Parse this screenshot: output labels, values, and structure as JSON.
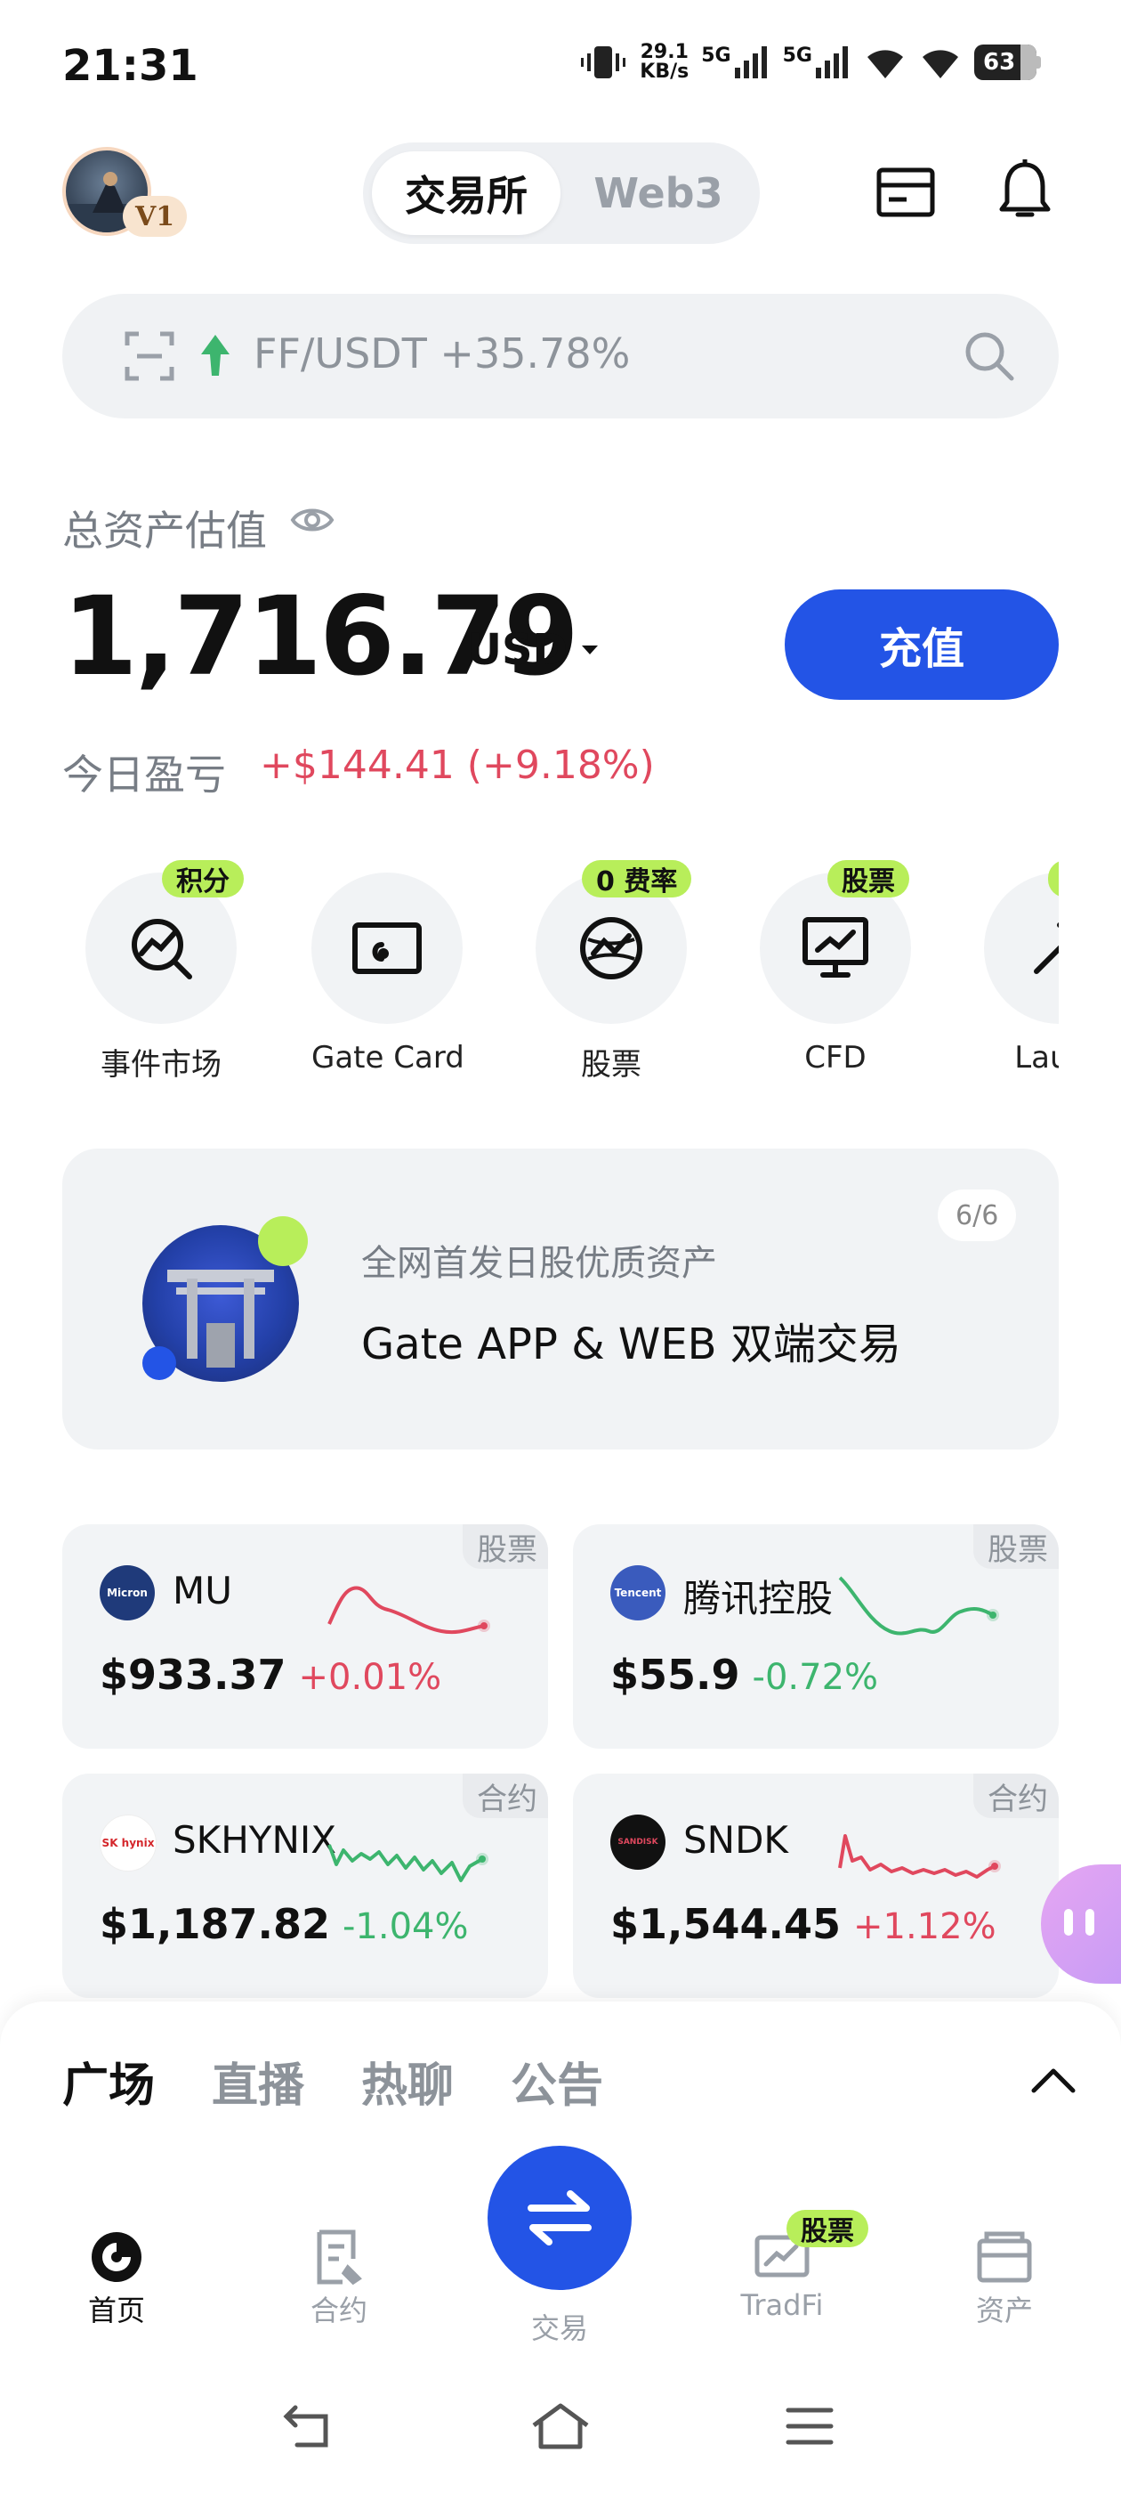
{
  "status_bar": {
    "time": "21:31",
    "net_speed_value": "29.1",
    "net_speed_unit": "KB/s",
    "sim1": "5G",
    "sim2": "5G",
    "battery": "63"
  },
  "header": {
    "avatar_badge": "V1",
    "tabs": [
      "交易所",
      "Web3"
    ],
    "active_tab": "交易所"
  },
  "search": {
    "trending_text": "FF/USDT +35.78%"
  },
  "assets": {
    "label": "总资产估值",
    "balance": "1,716.79",
    "currency": "USD",
    "deposit_label": "充值",
    "pnl_label": "今日盈亏",
    "pnl_value": "+$144.41 (+9.18%)"
  },
  "shortcuts": [
    {
      "label": "事件市场",
      "tag": "积分",
      "icon": "chart-search-icon"
    },
    {
      "label": "Gate Card",
      "tag": "",
      "icon": "card-icon"
    },
    {
      "label": "股票",
      "tag": "0 费率",
      "icon": "globe-icon"
    },
    {
      "label": "CFD",
      "tag": "股票",
      "icon": "monitor-chart-icon"
    },
    {
      "label": "Launc",
      "tag": "",
      "icon": "rocket-icon"
    }
  ],
  "banner": {
    "subtitle": "全网首发日股优质资产",
    "title": "Gate APP & WEB 双端交易",
    "page": "6/6"
  },
  "markets": [
    {
      "tag": "股票",
      "logo_text": "Micron",
      "name": "MU",
      "price": "$933.37",
      "change": "+0.01%",
      "trend": "up",
      "color": "#e0485e"
    },
    {
      "tag": "股票",
      "logo_text": "Tencent",
      "name": "腾讯控股",
      "price": "$55.9",
      "change": "-0.72%",
      "trend": "down",
      "color": "#3db56e"
    },
    {
      "tag": "合约",
      "logo_text": "SK hynix",
      "name": "SKHYNIX",
      "price": "$1,187.82",
      "change": "-1.04%",
      "trend": "down",
      "color": "#3db56e"
    },
    {
      "tag": "合约",
      "logo_text": "SANDISK",
      "name": "SNDK",
      "price": "$1,544.45",
      "change": "+1.12%",
      "trend": "up",
      "color": "#e0485e"
    }
  ],
  "sheet_tabs": [
    "广场",
    "直播",
    "热聊",
    "公告"
  ],
  "bottom_nav": [
    {
      "label": "首页",
      "icon": "home-icon",
      "active": true
    },
    {
      "label": "合约",
      "icon": "contract-icon",
      "active": false
    },
    {
      "label": "交易",
      "icon": "swap-icon",
      "active": false
    },
    {
      "label": "TradFi",
      "icon": "tradfi-icon",
      "active": false,
      "tag": "股票"
    },
    {
      "label": "资产",
      "icon": "wallet-icon",
      "active": false
    }
  ],
  "colors": {
    "accent_blue": "#2354e6",
    "up_red": "#e0485e",
    "down_green": "#3db56e",
    "tag_lime": "#b8ee5a"
  }
}
